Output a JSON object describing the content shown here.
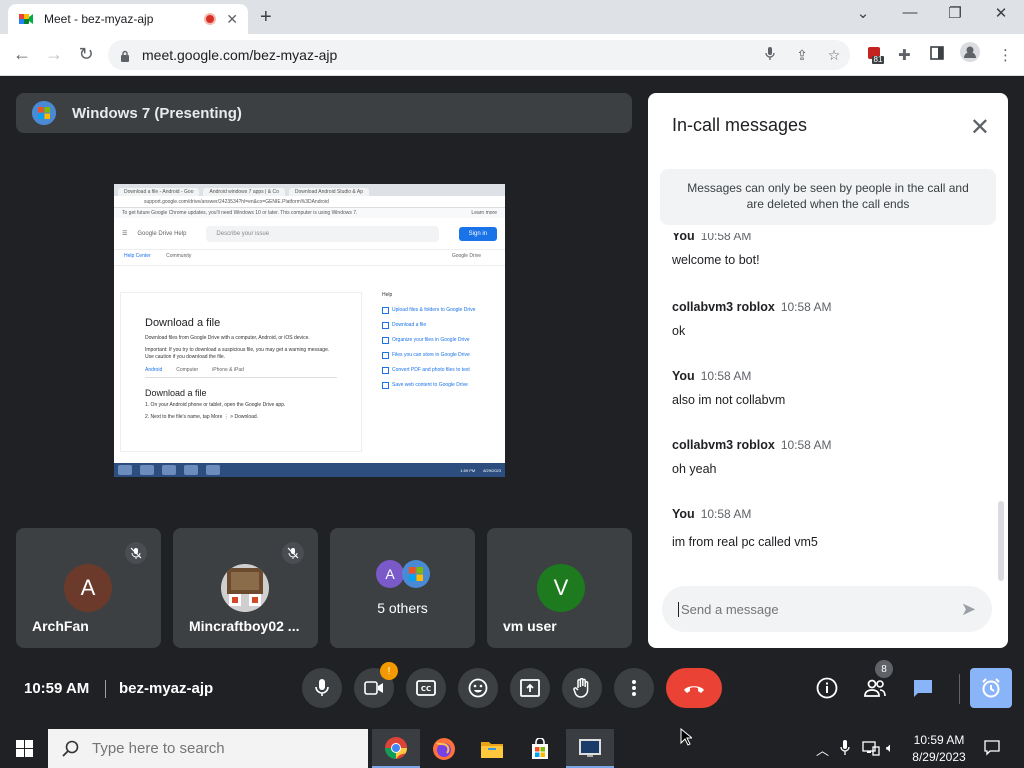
{
  "browser": {
    "tab_title": "Meet - bez-myaz-ajp",
    "url": "meet.google.com/bez-myaz-ajp",
    "extension_badge": "81",
    "icons": [
      "meet-favicon",
      "recording-dot",
      "close-icon",
      "new-tab-icon",
      "minimize-icon",
      "restore-icon",
      "close-window-icon",
      "back-icon",
      "forward-icon",
      "reload-icon",
      "lock-icon",
      "mic-icon",
      "share-icon",
      "star-icon",
      "extensions-icon",
      "sidebar-icon",
      "profile-icon",
      "kebab-menu-icon"
    ]
  },
  "presenting": {
    "label": "Windows 7 (Presenting)"
  },
  "shared_screen": {
    "tabs": [
      "Download a file - Android - Goo",
      "Android windows 7 apps | & Co",
      "Download Android Studio & Ap"
    ],
    "url": "support.google.com/drive/answer/2423534?hl=en&co=GENIE.Platform%3DAndroid",
    "info_bar": "To get future Google Chrome updates, you'll need Windows 10 or later. This computer is using Windows 7.",
    "info_more": "Learn more",
    "help_title": "Google Drive Help",
    "search_placeholder": "Describe your issue",
    "sign_in": "Sign in",
    "nav": [
      "Help Center",
      "Community"
    ],
    "nav_right": "Google Drive",
    "article_title": "Download a file",
    "article_p1": "Download files from Google Drive with a computer, Android, or iOS device.",
    "article_p2": "Important: If you try to download a suspicious file, you may get a warning message. Use caution if you download the file.",
    "subtabs": [
      "Android",
      "Computer",
      "iPhone & iPad"
    ],
    "section_title": "Download a file",
    "steps": [
      "1. On your Android phone or tablet, open the Google Drive app.",
      "2. Next to the file's name, tap More ⋮ > Download."
    ],
    "side_header": "Help",
    "side_items": [
      "Upload files & folders to Google Drive",
      "Download a file",
      "Organize your files in Google Drive",
      "Files you can store in Google Drive",
      "Convert PDF and photo files to text",
      "Save web content to Google Drive"
    ],
    "time": "1:59 PM",
    "date": "8/29/2023"
  },
  "participants": [
    {
      "name": "ArchFan",
      "initial": "A",
      "color": "#6b3a2b",
      "muted": true
    },
    {
      "name": "Mincraftboy02 ...",
      "initial": "",
      "color": "#8a6b4a",
      "muted": true
    },
    {
      "name": "5 others",
      "initial": "A",
      "color": "#7a5ac9",
      "muted": false
    },
    {
      "name": "vm user",
      "initial": "V",
      "color": "#1e7a1e",
      "muted": false
    }
  ],
  "chat": {
    "title": "In-call messages",
    "notice": "Messages can only be seen by people in the call and are deleted when the call ends",
    "messages": [
      {
        "who": "You",
        "when": "10:58 AM",
        "text": "welcome to bot!"
      },
      {
        "who": "collabvm3 roblox",
        "when": "10:58 AM",
        "text": "ok"
      },
      {
        "who": "You",
        "when": "10:58 AM",
        "text": "also im not collabvm"
      },
      {
        "who": "collabvm3 roblox",
        "when": "10:58 AM",
        "text": "oh yeah"
      },
      {
        "who": "You",
        "when": "10:58 AM",
        "text": "im from real pc called vm5"
      }
    ],
    "input_placeholder": "Send a message"
  },
  "controls": {
    "time": "10:59 AM",
    "meeting_code": "bez-myaz-ajp",
    "people_count": "8",
    "camera_alert": "!"
  },
  "taskbar": {
    "search_placeholder": "Type here to search",
    "time": "10:59 AM",
    "date": "8/29/2023"
  }
}
